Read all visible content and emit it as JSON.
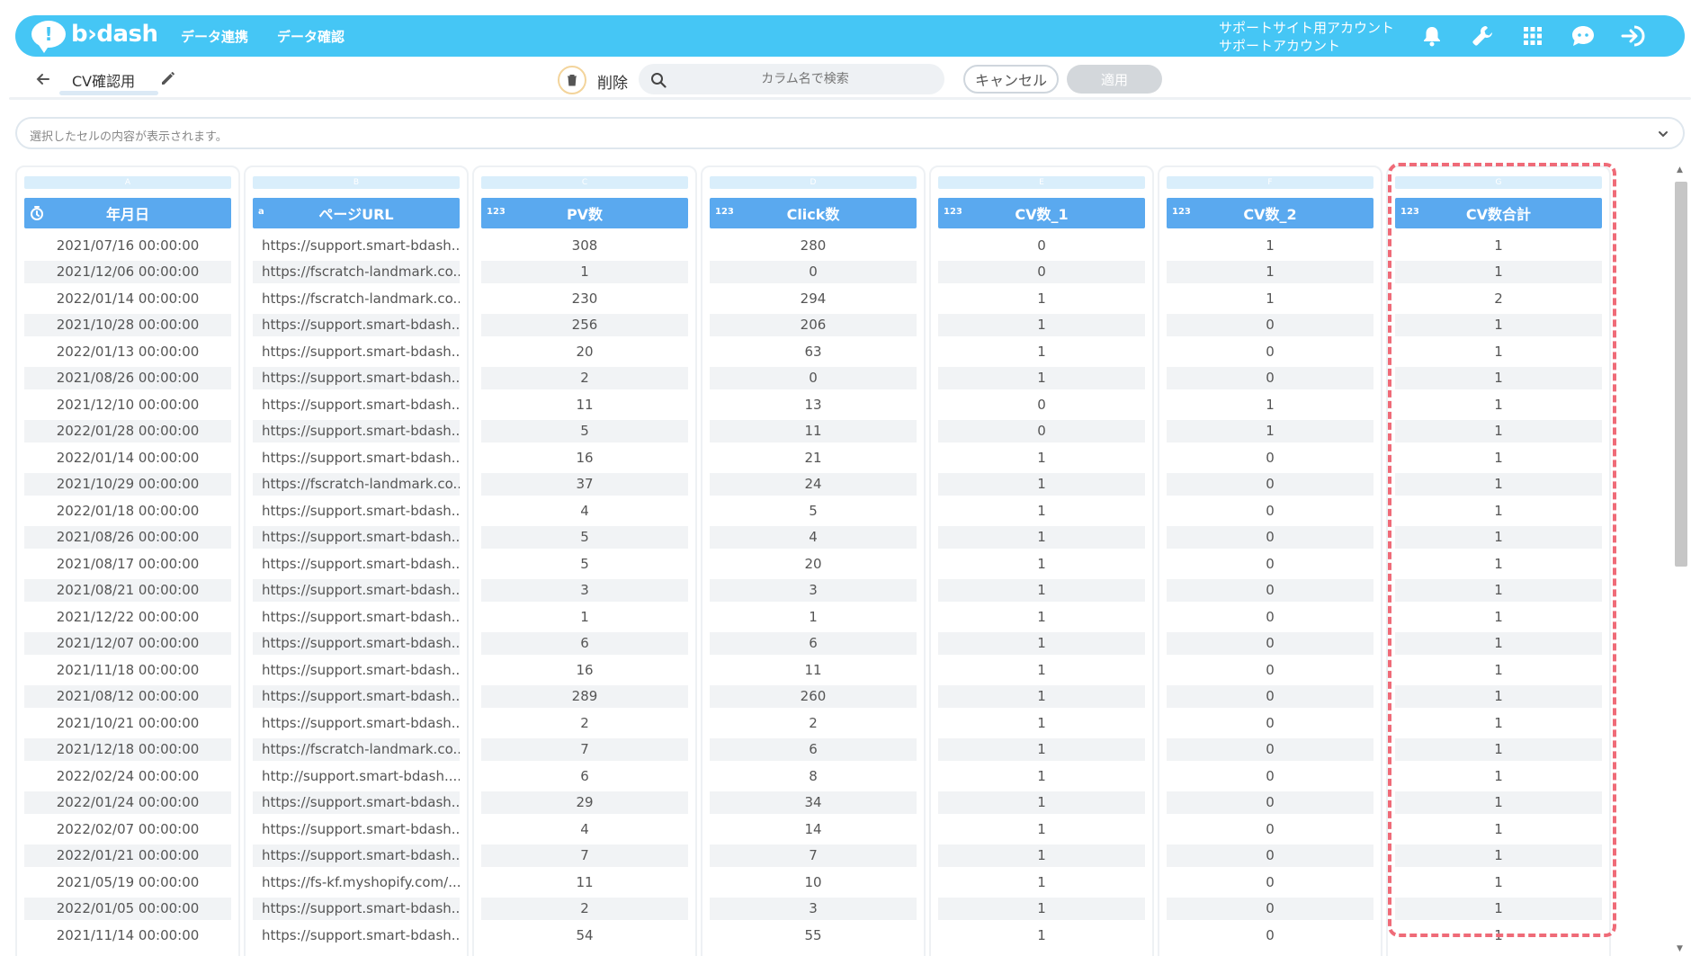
{
  "header": {
    "logo_text": "b›dash",
    "nav": [
      "データ連携",
      "データ確認"
    ],
    "account_line1": "サポートサイト用アカウント",
    "account_line2": "サポートアカウント"
  },
  "toolbar": {
    "title": "CV確認用",
    "delete_label": "削除",
    "search_placeholder": "カラム名で検索",
    "cancel_label": "キャンセル",
    "apply_label": "適用"
  },
  "cell_viewer": {
    "placeholder": "選択したセルの内容が表示されます。"
  },
  "colors": {
    "primary": "#45c6f5",
    "header": "#5aa9ef",
    "highlight": "#ef6b78"
  },
  "columns": [
    {
      "letter": "A",
      "title": "年月日",
      "type": "date",
      "cells": [
        "2021/07/16 00:00:00",
        "2021/12/06 00:00:00",
        "2022/01/14 00:00:00",
        "2021/10/28 00:00:00",
        "2022/01/13 00:00:00",
        "2021/08/26 00:00:00",
        "2021/12/10 00:00:00",
        "2022/01/28 00:00:00",
        "2022/01/14 00:00:00",
        "2021/10/29 00:00:00",
        "2022/01/18 00:00:00",
        "2021/08/26 00:00:00",
        "2021/08/17 00:00:00",
        "2021/08/21 00:00:00",
        "2021/12/22 00:00:00",
        "2021/12/07 00:00:00",
        "2021/11/18 00:00:00",
        "2021/08/12 00:00:00",
        "2021/10/21 00:00:00",
        "2021/12/18 00:00:00",
        "2022/02/24 00:00:00",
        "2022/01/24 00:00:00",
        "2022/02/07 00:00:00",
        "2022/01/21 00:00:00",
        "2021/05/19 00:00:00",
        "2022/01/05 00:00:00",
        "2021/11/14 00:00:00"
      ]
    },
    {
      "letter": "B",
      "title": "ページURL",
      "type": "text",
      "badge": "a",
      "cells": [
        "https://support.smart-bdash...",
        "https://fscratch-landmark.co...",
        "https://fscratch-landmark.co...",
        "https://support.smart-bdash...",
        "https://support.smart-bdash...",
        "https://support.smart-bdash...",
        "https://support.smart-bdash...",
        "https://support.smart-bdash...",
        "https://support.smart-bdash...",
        "https://fscratch-landmark.co...",
        "https://support.smart-bdash...",
        "https://support.smart-bdash...",
        "https://support.smart-bdash...",
        "https://support.smart-bdash...",
        "https://support.smart-bdash...",
        "https://support.smart-bdash...",
        "https://support.smart-bdash...",
        "https://support.smart-bdash...",
        "https://support.smart-bdash...",
        "https://fscratch-landmark.co...",
        "http://support.smart-bdash....",
        "https://support.smart-bdash...",
        "https://support.smart-bdash...",
        "https://support.smart-bdash...",
        "https://fs-kf.myshopify.com/...",
        "https://support.smart-bdash...",
        "https://support.smart-bdash..."
      ]
    },
    {
      "letter": "C",
      "title": "PV数",
      "type": "number",
      "badge": "123",
      "cells": [
        "308",
        "1",
        "230",
        "256",
        "20",
        "2",
        "11",
        "5",
        "16",
        "37",
        "4",
        "5",
        "5",
        "3",
        "1",
        "6",
        "16",
        "289",
        "2",
        "7",
        "6",
        "29",
        "4",
        "7",
        "11",
        "2",
        "54"
      ]
    },
    {
      "letter": "D",
      "title": "Click数",
      "type": "number",
      "badge": "123",
      "cells": [
        "280",
        "0",
        "294",
        "206",
        "63",
        "0",
        "13",
        "11",
        "21",
        "24",
        "5",
        "4",
        "20",
        "3",
        "1",
        "6",
        "11",
        "260",
        "2",
        "6",
        "8",
        "34",
        "14",
        "7",
        "10",
        "3",
        "55"
      ]
    },
    {
      "letter": "E",
      "title": "CV数_1",
      "type": "number",
      "badge": "123",
      "cells": [
        "0",
        "0",
        "1",
        "1",
        "1",
        "1",
        "0",
        "0",
        "1",
        "1",
        "1",
        "1",
        "1",
        "1",
        "1",
        "1",
        "1",
        "1",
        "1",
        "1",
        "1",
        "1",
        "1",
        "1",
        "1",
        "1",
        "1"
      ]
    },
    {
      "letter": "F",
      "title": "CV数_2",
      "type": "number",
      "badge": "123",
      "cells": [
        "1",
        "1",
        "1",
        "0",
        "0",
        "0",
        "1",
        "1",
        "0",
        "0",
        "0",
        "0",
        "0",
        "0",
        "0",
        "0",
        "0",
        "0",
        "0",
        "0",
        "0",
        "0",
        "0",
        "0",
        "0",
        "0",
        "0"
      ]
    },
    {
      "letter": "G",
      "title": "CV数合計",
      "type": "number",
      "badge": "123",
      "cells": [
        "1",
        "1",
        "2",
        "1",
        "1",
        "1",
        "1",
        "1",
        "1",
        "1",
        "1",
        "1",
        "1",
        "1",
        "1",
        "1",
        "1",
        "1",
        "1",
        "1",
        "1",
        "1",
        "1",
        "1",
        "1",
        "1",
        "1"
      ]
    }
  ]
}
